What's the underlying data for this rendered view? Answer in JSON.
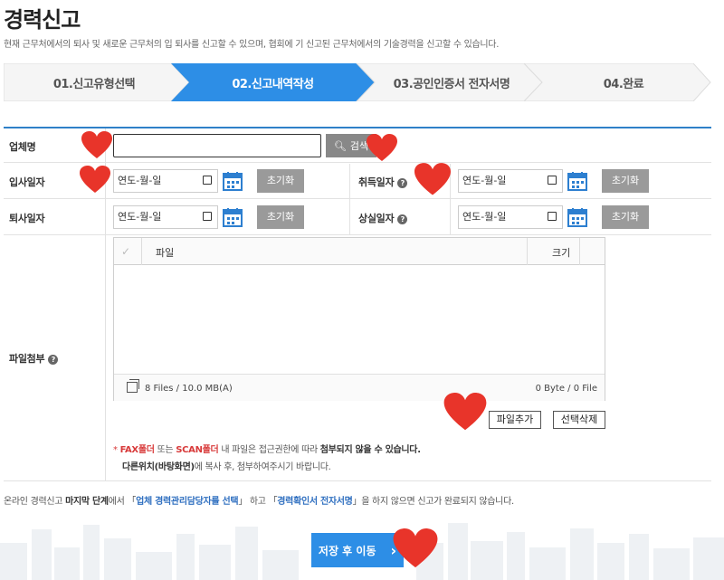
{
  "page": {
    "title": "경력신고",
    "description": "현재 근무처에서의 퇴사 및 새로운 근무처의 입 퇴사를 신고할 수 있으며, 협회에 기 신고된 근무처에서의 기술경력을 신고할 수 있습니다."
  },
  "steps": [
    {
      "label": "01.신고유형선택",
      "active": false
    },
    {
      "label": "02.신고내역작성",
      "active": true
    },
    {
      "label": "03.공인인증서 전자서명",
      "active": false
    },
    {
      "label": "04.완료",
      "active": false
    }
  ],
  "form": {
    "company": {
      "label": "업체명",
      "value": "",
      "search_label": "검색"
    },
    "hire_date": {
      "label": "입사일자",
      "placeholder": "연도-월-일",
      "reset_label": "초기화"
    },
    "acquire_date": {
      "label": "취득일자",
      "placeholder": "연도-월-일",
      "reset_label": "초기화"
    },
    "resign_date": {
      "label": "퇴사일자",
      "placeholder": "연도-월-일",
      "reset_label": "초기화"
    },
    "loss_date": {
      "label": "상실일자",
      "placeholder": "연도-월-일",
      "reset_label": "초기화"
    },
    "attachment": {
      "label": "파일첨부",
      "col_file": "파일",
      "col_size": "크기",
      "file_count": "8 Files / 10.0 MB(A)",
      "file_total": "0 Byte / 0 File",
      "add_label": "파일추가",
      "delete_label": "선택삭제"
    }
  },
  "notice": {
    "bullet": "*",
    "fax_folder": "FAX폴더",
    "or": " 또는 ",
    "scan_folder": "SCAN폴더",
    "middle": " 내 파일은 접근권한에 따라 ",
    "bold_tail": "첨부되지 않을 수 있습니다.",
    "line2_bold": "다른위치(바탕화면)",
    "line2_rest": "에 복사 후, 첨부하여주시기 바랍니다."
  },
  "footer": {
    "p1": "온라인 경력신고 ",
    "p2": "마지막 단계",
    "p3": "에서 「",
    "p4": "업체 경력관리담당자를 선택",
    "p5": "」 하고 「",
    "p6": "경력확인서 전자서명",
    "p7": "」을 하지 않으면 신고가 완료되지 않습니다."
  },
  "save_button": {
    "label": "저장 후 이동",
    "arrow": "›"
  },
  "colors": {
    "accent": "#2d8ee6",
    "step_active": "#2d8ee6",
    "heart": "#e8342a"
  }
}
